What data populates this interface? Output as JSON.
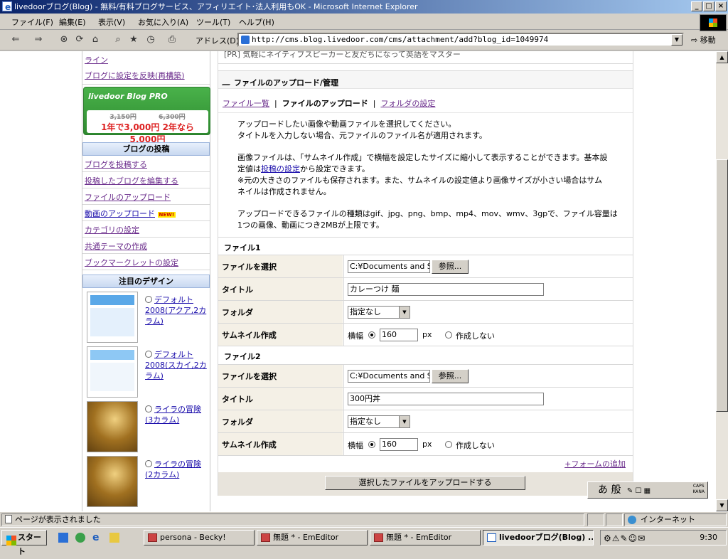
{
  "window": {
    "title": "livedoorブログ(Blog) - 無料/有料ブログサービス、アフィリエイト･法人利用もOK - Microsoft Internet Explorer",
    "btn_min": "_",
    "btn_max": "□",
    "btn_close": "×"
  },
  "menu": [
    "ファイル(F)",
    "編集(E)",
    "表示(V)",
    "お気に入り(A)",
    "ツール(T)",
    "ヘルプ(H)"
  ],
  "toolbar": {
    "address_label": "アドレス(D)",
    "address_value": "http://cms.blog.livedoor.com/cms/attachment/add?blog_id=1049974",
    "go_label": "移動"
  },
  "sidebar": {
    "top_links": [
      "ライン",
      "ブログに設定を反映(再構築)"
    ],
    "pro_banner": {
      "title": "livedoor Blog PRO",
      "old1": "3,150円",
      "old2": "6,300円",
      "deal": "1年で3,000円 2年なら5,000円"
    },
    "post_header": "ブログの投稿",
    "post_items": [
      "ブログを投稿する",
      "投稿したブログを編集する",
      "ファイルのアップロード",
      "動画のアップロード",
      "カテゴリの設定",
      "共通テーマの作成",
      "ブックマークレットの設定"
    ],
    "new_badge": "NEW!",
    "design_header": "注目のデザイン",
    "designs": [
      "デフォルト2008(アクア,2カラム)",
      "デフォルト2008(スカイ,2カラム)",
      "ライラの冒険(3カラム)",
      "ライラの冒険(2カラム)"
    ]
  },
  "main": {
    "pr_line": "[PR] 気軽にネイティブスピーカーと友だちになって英語をマスター",
    "heading": "ファイルのアップロード/管理",
    "tabs": [
      "ファイル一覧",
      "ファイルのアップロード",
      "フォルダの設定"
    ],
    "tab_sep": "|",
    "instr1": "アップロードしたい画像や動画ファイルを選択してください。",
    "instr2": "タイトルを入力しない場合、元ファイルのファイル名が適用されます。",
    "instr3a": "画像ファイルは、「サムネイル作成」で横幅を設定したサイズに縮小して表示することができます。基本設",
    "instr3b": "定値は",
    "instr3link": "投稿の設定",
    "instr3c": "から設定できます。",
    "instr4": "※元の大きさのファイルも保存されます。また、サムネイルの設定値より画像サイズが小さい場合はサム",
    "instr5": "ネイルは作成されません。",
    "instr6": "アップロードできるファイルの種類はgif、jpg、png、bmp、mp4、mov、wmv、3gpで、ファイル容量は",
    "instr7": "1つの画像、動画につき2MBが上限です。",
    "files": [
      {
        "heading": "ファイル1",
        "lbl_select": "ファイルを選択",
        "file_value": "C:¥Documents and S",
        "browse": "参照...",
        "lbl_title": "タイトル",
        "title_value": "カレーつけ 麺",
        "lbl_folder": "フォルダ",
        "folder_value": "指定なし",
        "lbl_thumb": "サムネイル作成",
        "width_label": "横幅",
        "width_value": "160",
        "px": "px",
        "no_thumb": "作成しない"
      },
      {
        "heading": "ファイル2",
        "lbl_select": "ファイルを選択",
        "file_value": "C:¥Documents and S",
        "browse": "参照...",
        "lbl_title": "タイトル",
        "title_value": "300円丼",
        "lbl_folder": "フォルダ",
        "folder_value": "指定なし",
        "lbl_thumb": "サムネイル作成",
        "width_label": "横幅",
        "width_value": "160",
        "px": "px",
        "no_thumb": "作成しない"
      }
    ],
    "add_form": "+フォームの追加",
    "submit": "選択したファイルをアップロードする"
  },
  "ime": {
    "text": "あ 般",
    "caps": "CAPS",
    "kana": "KANA"
  },
  "status": {
    "text": "ページが表示されました",
    "zone": "インターネット"
  },
  "taskbar": {
    "start": "スタート",
    "tasks": [
      "persona - Becky!",
      "無題 * - EmEditor",
      "無題 * - EmEditor",
      "livedoorブログ(Blog) ..."
    ],
    "clock": "9:30"
  }
}
